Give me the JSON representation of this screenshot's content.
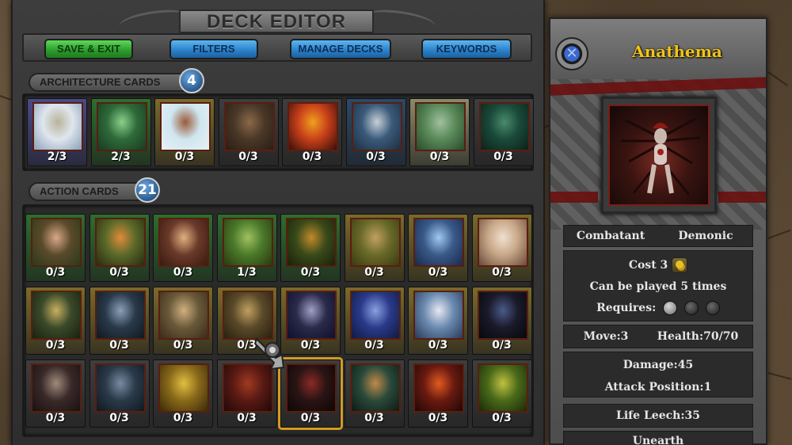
{
  "editor": {
    "title": "DECK EDITOR",
    "buttons": {
      "save_exit": "SAVE & EXIT",
      "filters": "FILTERS",
      "manage_decks": "MANAGE DECKS",
      "keywords": "KEYWORDS"
    }
  },
  "architecture": {
    "label": "ARCHITECTURE CARDS",
    "count": "4",
    "cards": [
      {
        "count": "2/3",
        "frame": "#4a4a8a",
        "scene": "castle"
      },
      {
        "count": "2/3",
        "frame": "#2d6e2d",
        "scene": "forest-ruins"
      },
      {
        "count": "0/3",
        "frame": "#7a6a2a",
        "scene": "snow-temple"
      },
      {
        "count": "0/3",
        "frame": "#3e3e3e",
        "scene": "tree-city"
      },
      {
        "count": "0/3",
        "frame": "#3e3e3e",
        "scene": "fire-tower"
      },
      {
        "count": "0/3",
        "frame": "#2a4a6a",
        "scene": "cliff-city"
      },
      {
        "count": "0/3",
        "frame": "#8a8a6a",
        "scene": "jungle-fort"
      },
      {
        "count": "0/3",
        "frame": "#3e3e3e",
        "scene": "swamp"
      }
    ]
  },
  "action": {
    "label": "ACTION CARDS",
    "count": "21",
    "rows": [
      [
        {
          "count": "0/3",
          "frame": "#2d6e2d",
          "scene": "elf-portrait"
        },
        {
          "count": "0/3",
          "frame": "#2d6e2d",
          "scene": "fire-dancer"
        },
        {
          "count": "0/3",
          "frame": "#2d6e2d",
          "scene": "monk"
        },
        {
          "count": "1/3",
          "frame": "#2d6e2d",
          "scene": "forest-glade"
        },
        {
          "count": "0/3",
          "frame": "#2d6e2d",
          "scene": "dark-woods"
        },
        {
          "count": "0/3",
          "frame": "#7a6a2a",
          "scene": "hobbit-door"
        },
        {
          "count": "0/3",
          "frame": "#7a6a2a",
          "scene": "fairy"
        },
        {
          "count": "0/3",
          "frame": "#7a6a2a",
          "scene": "angel"
        }
      ],
      [
        {
          "count": "0/3",
          "frame": "#7a6a2a",
          "scene": "witch"
        },
        {
          "count": "0/3",
          "frame": "#7a6a2a",
          "scene": "dark-knight"
        },
        {
          "count": "0/3",
          "frame": "#7a6a2a",
          "scene": "sage"
        },
        {
          "count": "0/3",
          "frame": "#7a6a2a",
          "scene": "ranger"
        },
        {
          "count": "0/3",
          "frame": "#7a6a2a",
          "scene": "sorceress"
        },
        {
          "count": "0/3",
          "frame": "#7a6a2a",
          "scene": "blue-hall"
        },
        {
          "count": "0/3",
          "frame": "#7a6a2a",
          "scene": "wizard"
        },
        {
          "count": "0/3",
          "frame": "#7a6a2a",
          "scene": "shadow"
        }
      ],
      [
        {
          "count": "0/3",
          "frame": "#3e3e3e",
          "scene": "hooded"
        },
        {
          "count": "0/3",
          "frame": "#3e3e3e",
          "scene": "beast"
        },
        {
          "count": "0/3",
          "frame": "#3e3e3e",
          "scene": "golden-demon"
        },
        {
          "count": "0/3",
          "frame": "#3e3e3e",
          "scene": "hellhound"
        },
        {
          "count": "0/3",
          "frame": "#3e3e3e",
          "scene": "anathema",
          "selected": true
        },
        {
          "count": "0/3",
          "frame": "#3e3e3e",
          "scene": "vines"
        },
        {
          "count": "0/3",
          "frame": "#3e3e3e",
          "scene": "fire-dragon"
        },
        {
          "count": "0/3",
          "frame": "#3e3e3e",
          "scene": "green-spirit"
        }
      ]
    ]
  },
  "detail": {
    "name": "Anathema",
    "type": "Combatant",
    "race": "Demonic",
    "cost": "Cost 3",
    "plays": "Can be played 5 times",
    "requires": "Requires:",
    "move": "Move:3",
    "health": "Health:70/70",
    "damage": "Damage:45",
    "attack_position": "Attack Position:1",
    "life_leech": "Life Leech:35",
    "unearth": "Unearth"
  },
  "colors": {
    "accent_gold": "#f2c415",
    "button_green": "#2a9a2a",
    "button_blue": "#2a7fc8",
    "selected_border": "#d39a22"
  }
}
